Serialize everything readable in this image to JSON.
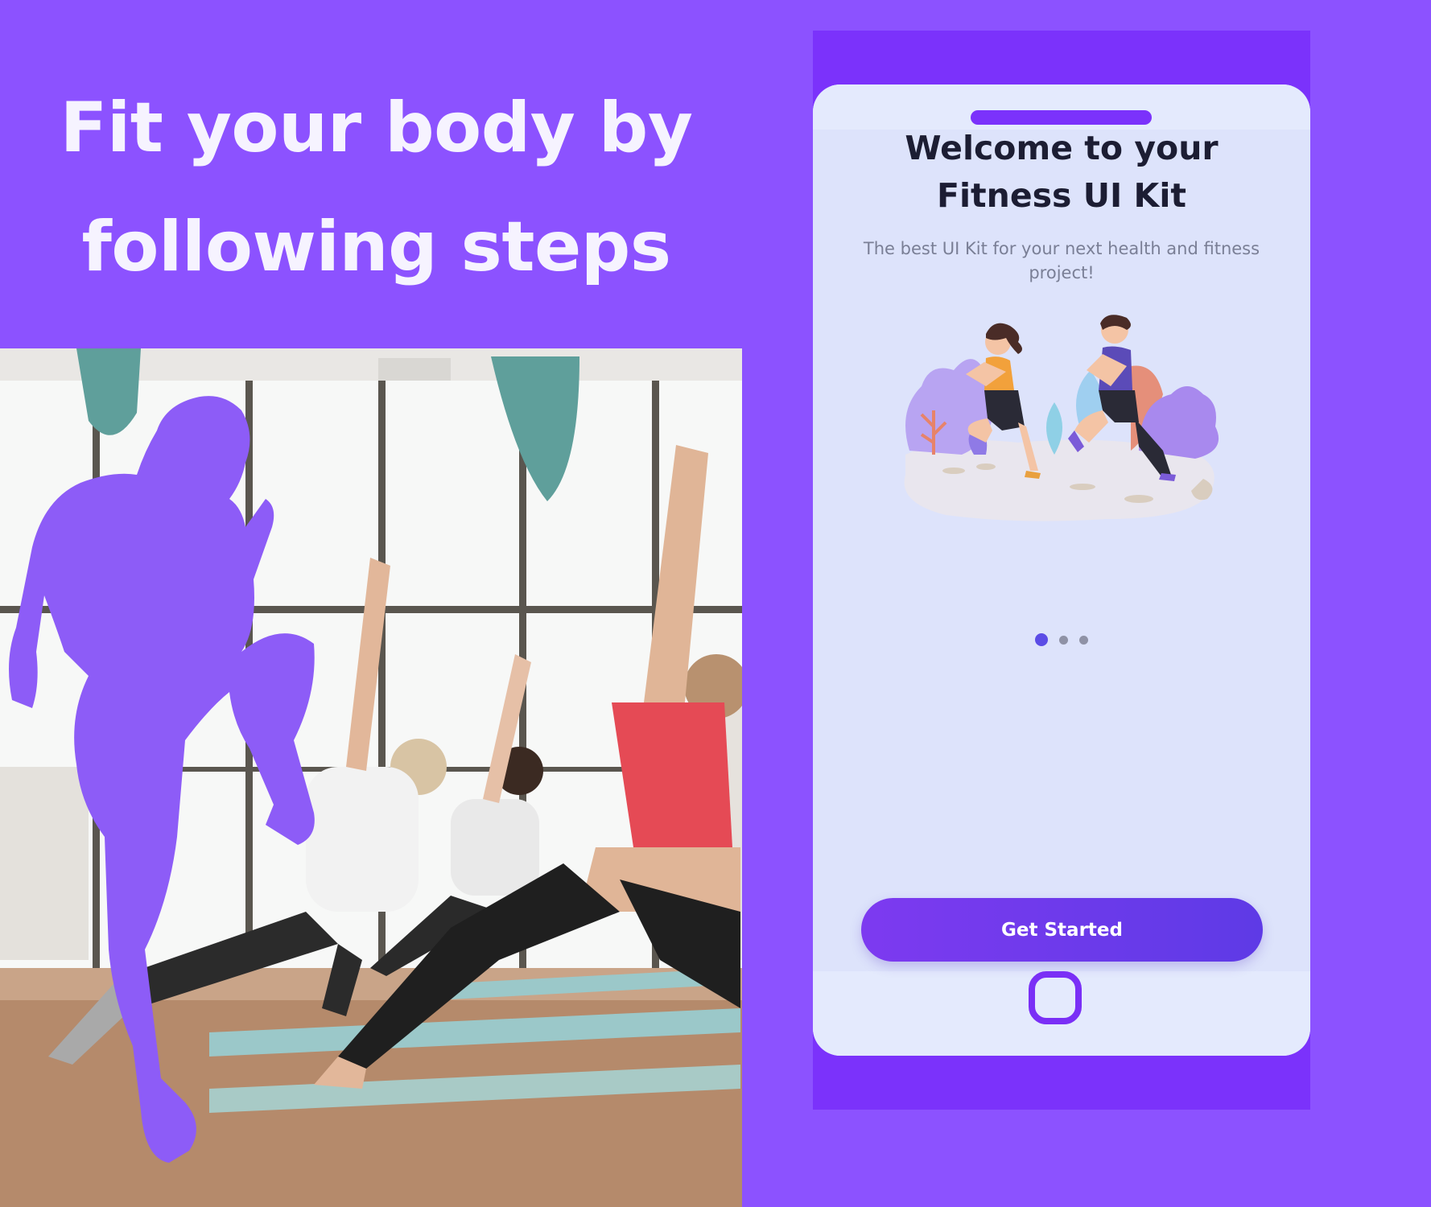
{
  "promo": {
    "headline_line1": "Fit your body by",
    "headline_line2": "following steps"
  },
  "phone": {
    "title_line1": "Welcome to your",
    "title_line2": "Fitness UI Kit",
    "subtitle": "The best UI Kit for your next health and fitness project!",
    "pagination": {
      "total": 3,
      "active_index": 0
    },
    "cta_label": "Get Started",
    "illustration": "two-runners-illustration"
  },
  "icons": {
    "home_button": "home-button-icon",
    "silhouette": "running-woman-silhouette"
  },
  "colors": {
    "background": "#8c52ff",
    "phone_frame": "#7b32fb",
    "screen": "#dde3fb",
    "accent": "#5b4ce6",
    "title_text": "#1c1d33",
    "headline_text": "#f6f3ff"
  }
}
